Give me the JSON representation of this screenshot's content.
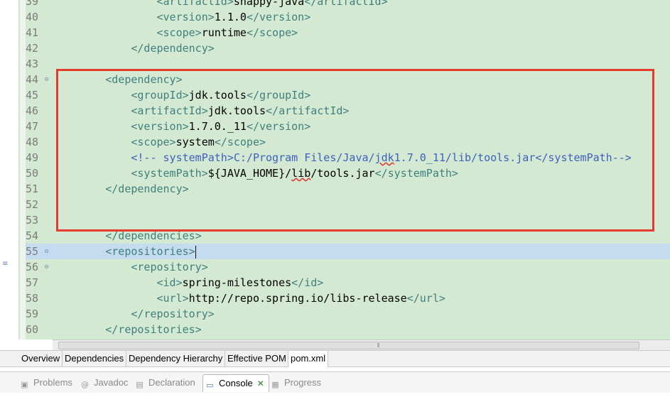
{
  "editor": {
    "lines": [
      {
        "num": "39",
        "fold": "",
        "indent": "        ",
        "parts": [
          [
            "tag",
            "<artifactId>"
          ],
          [
            "txt",
            "snappy-java"
          ],
          [
            "tag",
            "</artifactId>"
          ]
        ]
      },
      {
        "num": "40",
        "fold": "",
        "indent": "        ",
        "parts": [
          [
            "tag",
            "<version>"
          ],
          [
            "txt",
            "1.1.0"
          ],
          [
            "tag",
            "</version>"
          ]
        ]
      },
      {
        "num": "41",
        "fold": "",
        "indent": "        ",
        "parts": [
          [
            "tag",
            "<scope>"
          ],
          [
            "txt",
            "runtime"
          ],
          [
            "tag",
            "</scope>"
          ]
        ]
      },
      {
        "num": "42",
        "fold": "",
        "indent": "    ",
        "parts": [
          [
            "tag",
            "</dependency>"
          ]
        ]
      },
      {
        "num": "43",
        "fold": "",
        "indent": "",
        "parts": []
      },
      {
        "num": "44",
        "fold": "⊖",
        "indent": "",
        "parts": [
          [
            "tag",
            "<dependency>"
          ]
        ]
      },
      {
        "num": "45",
        "fold": "",
        "indent": "    ",
        "parts": [
          [
            "tag",
            "<groupId>"
          ],
          [
            "txt",
            "jdk.tools"
          ],
          [
            "tag",
            "</groupId>"
          ]
        ]
      },
      {
        "num": "46",
        "fold": "",
        "indent": "    ",
        "parts": [
          [
            "tag",
            "<artifactId>"
          ],
          [
            "txt",
            "jdk.tools"
          ],
          [
            "tag",
            "</artifactId>"
          ]
        ]
      },
      {
        "num": "47",
        "fold": "",
        "indent": "    ",
        "parts": [
          [
            "tag",
            "<version>"
          ],
          [
            "txt",
            "1.7.0._11"
          ],
          [
            "tag",
            "</version>"
          ]
        ]
      },
      {
        "num": "48",
        "fold": "",
        "indent": "    ",
        "parts": [
          [
            "tag",
            "<scope>"
          ],
          [
            "txt",
            "system"
          ],
          [
            "tag",
            "</scope>"
          ]
        ]
      },
      {
        "num": "49",
        "fold": "",
        "indent": "    ",
        "parts": [
          [
            "cmt",
            "<!-- systemPath>C:/Program Files/Java/jdk1.7.0_11/lib/tools.jar</systemPath-->"
          ]
        ]
      },
      {
        "num": "50",
        "fold": "",
        "indent": "    ",
        "parts": [
          [
            "tag",
            "<systemPath>"
          ],
          [
            "txt",
            "${JAVA_HOME}/lib/tools.jar"
          ],
          [
            "tag",
            "</systemPath>"
          ]
        ]
      },
      {
        "num": "51",
        "fold": "",
        "indent": "",
        "parts": [
          [
            "tag",
            "</dependency>"
          ]
        ]
      },
      {
        "num": "52",
        "fold": "",
        "indent": "",
        "parts": []
      },
      {
        "num": "53",
        "fold": "",
        "indent": "",
        "parts": []
      },
      {
        "num": "54",
        "fold": "",
        "indent": "",
        "parts": [
          [
            "tag",
            "</dependencies>"
          ]
        ]
      },
      {
        "num": "55",
        "fold": "⊖",
        "indent": "",
        "parts": [
          [
            "tag",
            "<repositories>"
          ]
        ],
        "current": true
      },
      {
        "num": "56",
        "fold": "⊖",
        "indent": "    ",
        "parts": [
          [
            "tag",
            "<repository>"
          ]
        ]
      },
      {
        "num": "57",
        "fold": "",
        "indent": "        ",
        "parts": [
          [
            "tag",
            "<id>"
          ],
          [
            "txt",
            "spring-milestones"
          ],
          [
            "tag",
            "</id>"
          ]
        ]
      },
      {
        "num": "58",
        "fold": "",
        "indent": "        ",
        "parts": [
          [
            "tag",
            "<url>"
          ],
          [
            "txt",
            "http://repo.spring.io/libs-release"
          ],
          [
            "tag",
            "</url>"
          ]
        ]
      },
      {
        "num": "59",
        "fold": "",
        "indent": "    ",
        "parts": [
          [
            "tag",
            "</repository>"
          ]
        ]
      },
      {
        "num": "60",
        "fold": "",
        "indent": "",
        "parts": [
          [
            "tag",
            "</repositories>"
          ]
        ]
      }
    ]
  },
  "scrollbar_grip": "⦀",
  "pom_tabs": [
    "Overview",
    "Dependencies",
    "Dependency Hierarchy",
    "Effective POM",
    "pom.xml"
  ],
  "pom_active": "pom.xml",
  "views": [
    {
      "label": "Problems",
      "icon": "problems-icon",
      "glyph": "▣"
    },
    {
      "label": "Javadoc",
      "icon": "javadoc-icon",
      "glyph": "@"
    },
    {
      "label": "Declaration",
      "icon": "declaration-icon",
      "glyph": "▤"
    },
    {
      "label": "Console",
      "icon": "console-icon",
      "glyph": "▭"
    },
    {
      "label": "Progress",
      "icon": "progress-icon",
      "glyph": "▦"
    }
  ],
  "active_view": "Console",
  "colors": {
    "editor_bg": "#d4e9d2",
    "highlight_border": "#e53b2f",
    "tag": "#3f7f7f",
    "comment": "#3f5fbf"
  }
}
